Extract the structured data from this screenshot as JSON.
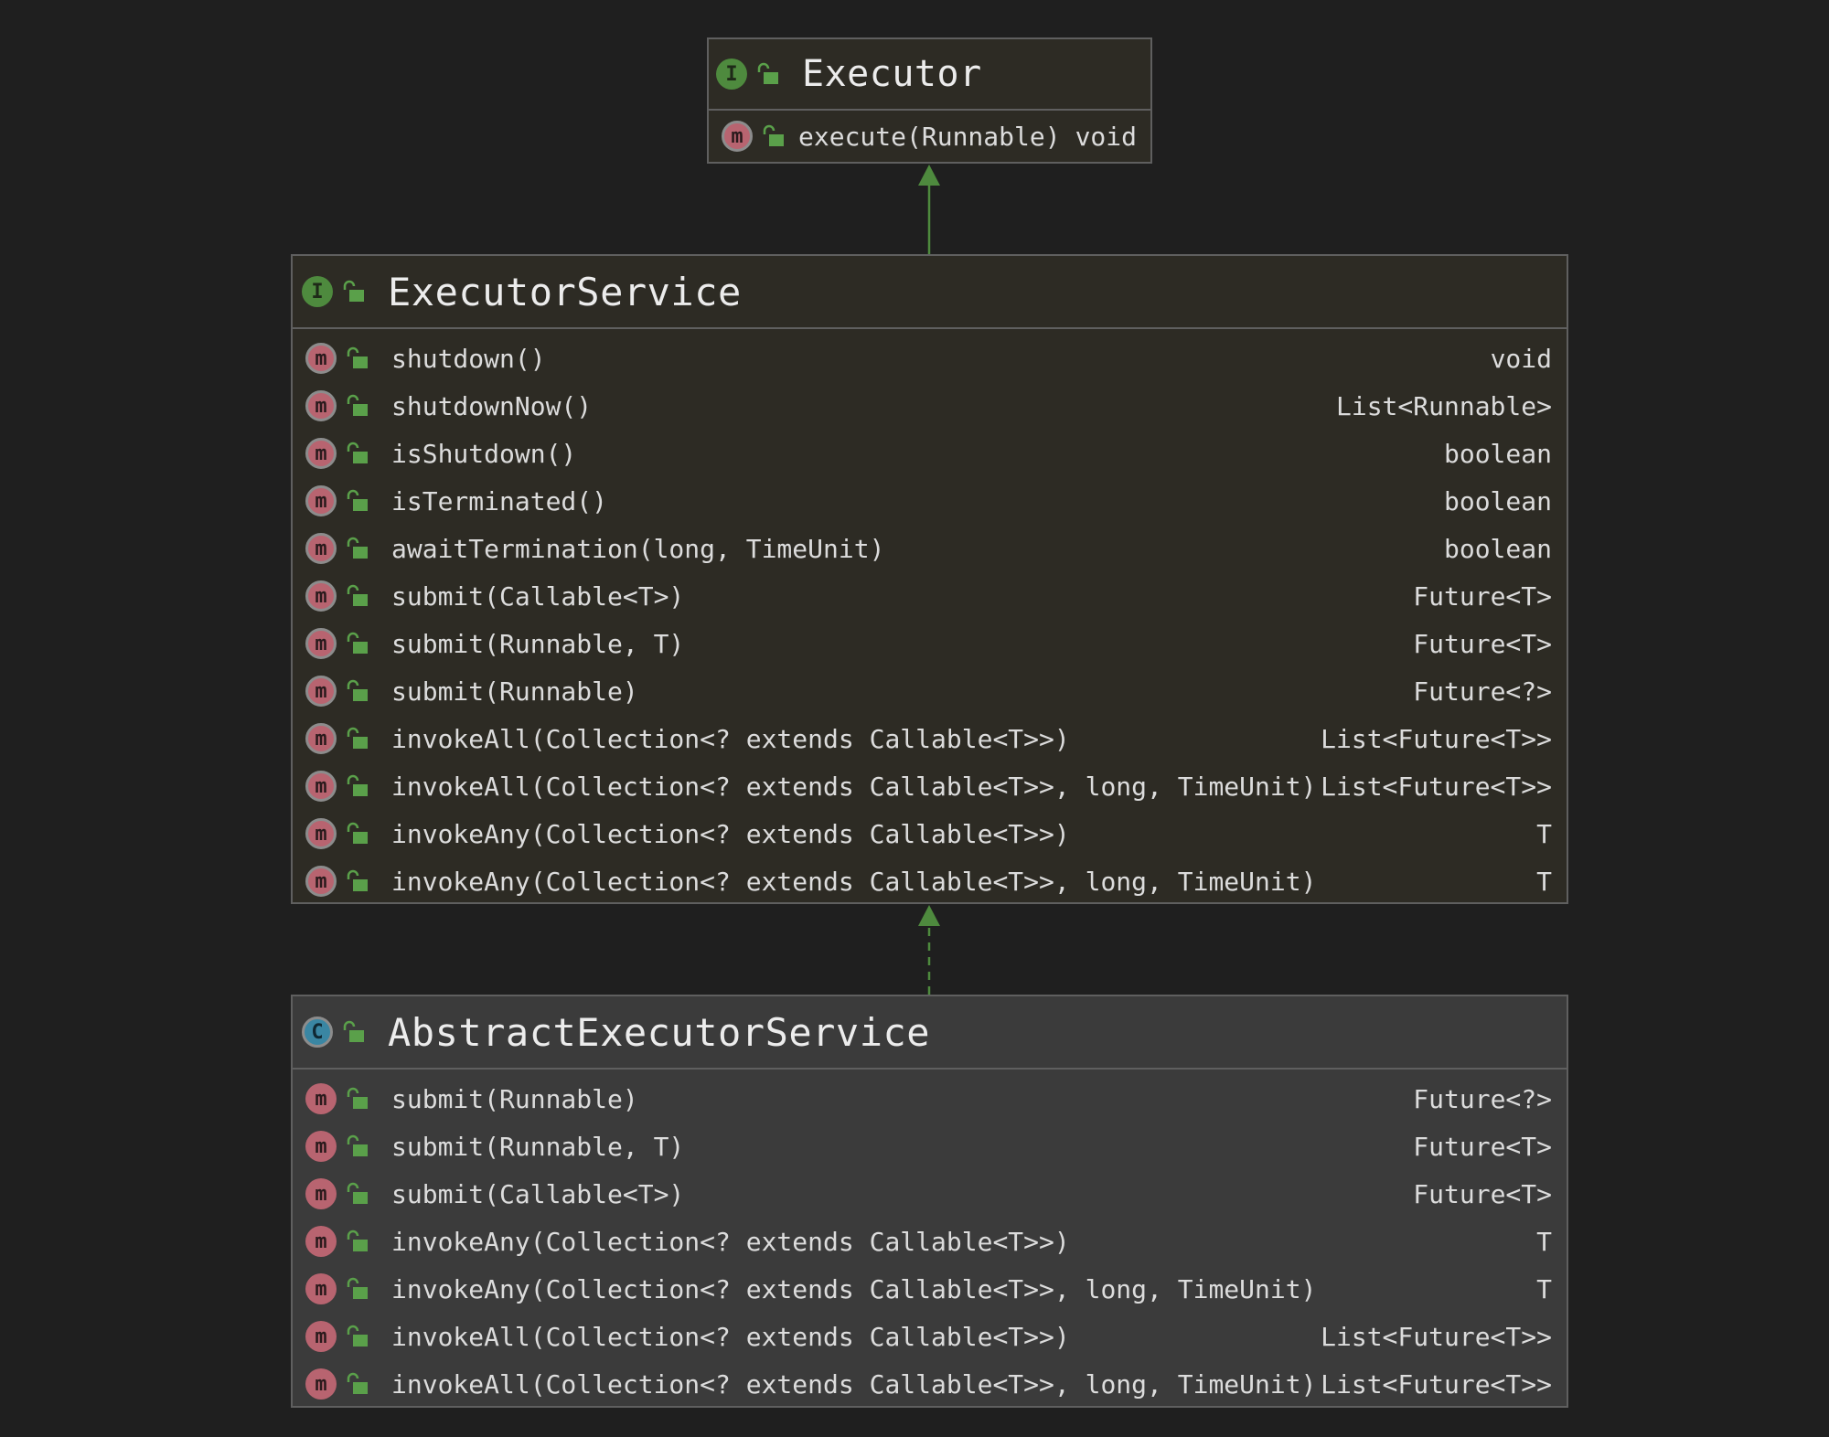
{
  "colors": {
    "background": "#1f1f1f",
    "interface_fill": "#2d2b24",
    "class_fill": "#3b3b3b",
    "border": "#5f5f5f",
    "arrow": "#4e8a3e",
    "method_badge": "#b86470",
    "interface_badge": "#4e8a3e",
    "class_badge": "#3a86a3"
  },
  "icons": {
    "interface": "interface-icon",
    "class": "abstract-class-icon",
    "method": "method-icon",
    "public": "public-lock-icon"
  },
  "executor": {
    "badge": "I",
    "name": "Executor",
    "methods": [
      {
        "badge": "m",
        "signature": "execute(Runnable)",
        "returns": "void"
      }
    ]
  },
  "executor_service": {
    "badge": "I",
    "name": "ExecutorService",
    "methods": [
      {
        "badge": "m",
        "signature": "shutdown()",
        "returns": "void"
      },
      {
        "badge": "m",
        "signature": "shutdownNow()",
        "returns": "List<Runnable>"
      },
      {
        "badge": "m",
        "signature": "isShutdown()",
        "returns": "boolean"
      },
      {
        "badge": "m",
        "signature": "isTerminated()",
        "returns": "boolean"
      },
      {
        "badge": "m",
        "signature": "awaitTermination(long, TimeUnit)",
        "returns": "boolean"
      },
      {
        "badge": "m",
        "signature": "submit(Callable<T>)",
        "returns": "Future<T>"
      },
      {
        "badge": "m",
        "signature": "submit(Runnable, T)",
        "returns": "Future<T>"
      },
      {
        "badge": "m",
        "signature": "submit(Runnable)",
        "returns": "Future<?>"
      },
      {
        "badge": "m",
        "signature": "invokeAll(Collection<? extends Callable<T>>)",
        "returns": "List<Future<T>>"
      },
      {
        "badge": "m",
        "signature": "invokeAll(Collection<? extends Callable<T>>, long, TimeUnit)",
        "returns": "List<Future<T>>"
      },
      {
        "badge": "m",
        "signature": "invokeAny(Collection<? extends Callable<T>>)",
        "returns": "T"
      },
      {
        "badge": "m",
        "signature": "invokeAny(Collection<? extends Callable<T>>, long, TimeUnit)",
        "returns": "T"
      }
    ]
  },
  "abstract_executor_service": {
    "badge": "C",
    "name": "AbstractExecutorService",
    "methods": [
      {
        "badge": "m",
        "signature": "submit(Runnable)",
        "returns": "Future<?>"
      },
      {
        "badge": "m",
        "signature": "submit(Runnable, T)",
        "returns": "Future<T>"
      },
      {
        "badge": "m",
        "signature": "submit(Callable<T>)",
        "returns": "Future<T>"
      },
      {
        "badge": "m",
        "signature": "invokeAny(Collection<? extends Callable<T>>)",
        "returns": "T"
      },
      {
        "badge": "m",
        "signature": "invokeAny(Collection<? extends Callable<T>>, long, TimeUnit)",
        "returns": "T"
      },
      {
        "badge": "m",
        "signature": "invokeAll(Collection<? extends Callable<T>>)",
        "returns": "List<Future<T>>"
      },
      {
        "badge": "m",
        "signature": "invokeAll(Collection<? extends Callable<T>>, long, TimeUnit)",
        "returns": "List<Future<T>>"
      }
    ]
  }
}
